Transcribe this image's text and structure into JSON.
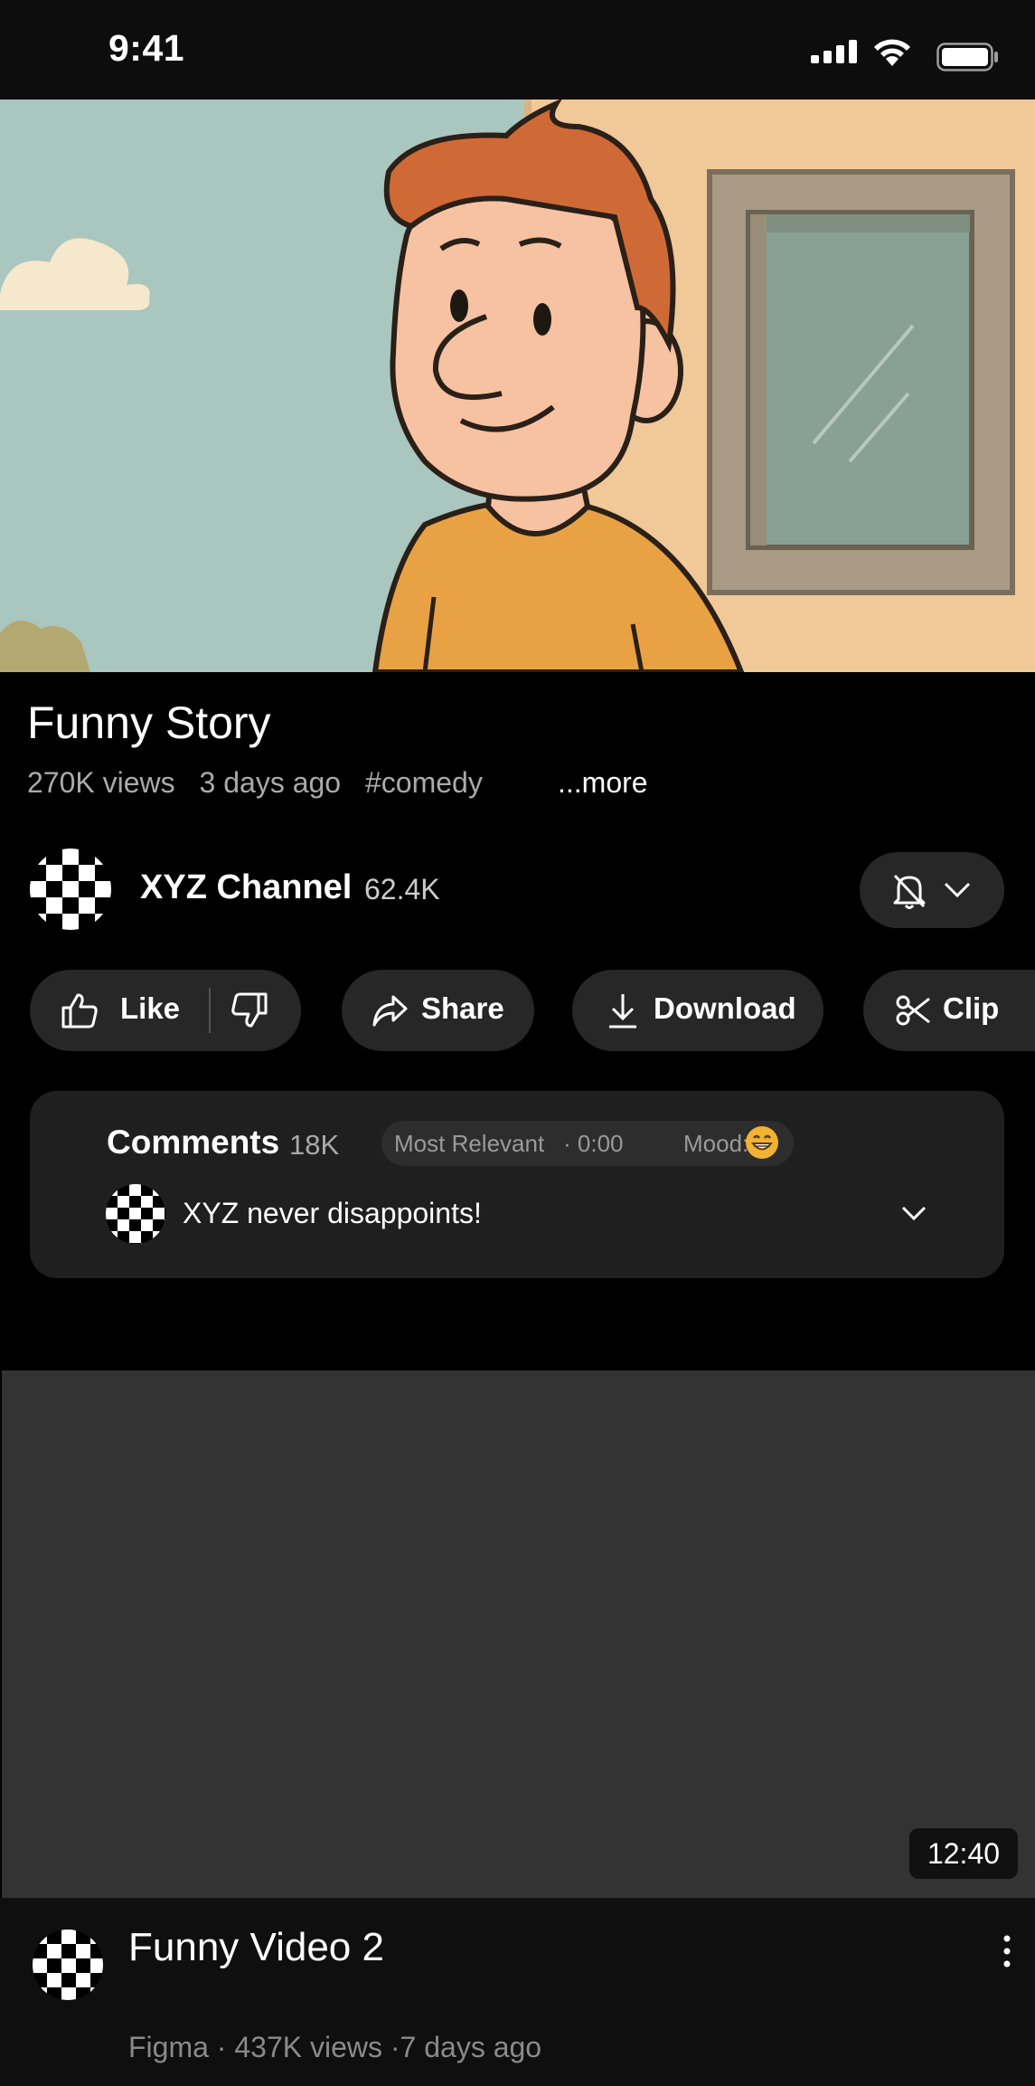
{
  "status_bar": {
    "time": "9:41"
  },
  "video": {
    "title": "Funny Story",
    "views": "270K views",
    "age": "3 days ago",
    "tag": "#comedy",
    "more_label": "...more"
  },
  "channel": {
    "name": "XYZ Channel",
    "subscribers": "62.4K"
  },
  "actions": {
    "like_label": "Like",
    "share_label": "Share",
    "download_label": "Download",
    "clip_label": "Clip"
  },
  "comments": {
    "title": "Comments",
    "count": "18K",
    "sort_label": "Most Relevant",
    "time_label": "· 0:00",
    "mood_label": "Mood:",
    "mood_emoji": "😁",
    "top_comment": "XYZ never disappoints!"
  },
  "next_video": {
    "duration": "12:40",
    "title": "Funny Video 2",
    "meta": "Figma · 437K views ·7 days ago"
  },
  "icons": [
    "signal-icon",
    "wifi-icon",
    "battery-icon",
    "bell-off-icon",
    "chevron-down-icon",
    "thumbs-up-icon",
    "thumbs-down-icon",
    "share-icon",
    "download-icon",
    "scissors-icon",
    "more-vert-icon"
  ],
  "colors": {
    "pill_bg": "#272727",
    "panel_bg": "#1f1f1f",
    "secondary_text": "#aaaaaa"
  }
}
